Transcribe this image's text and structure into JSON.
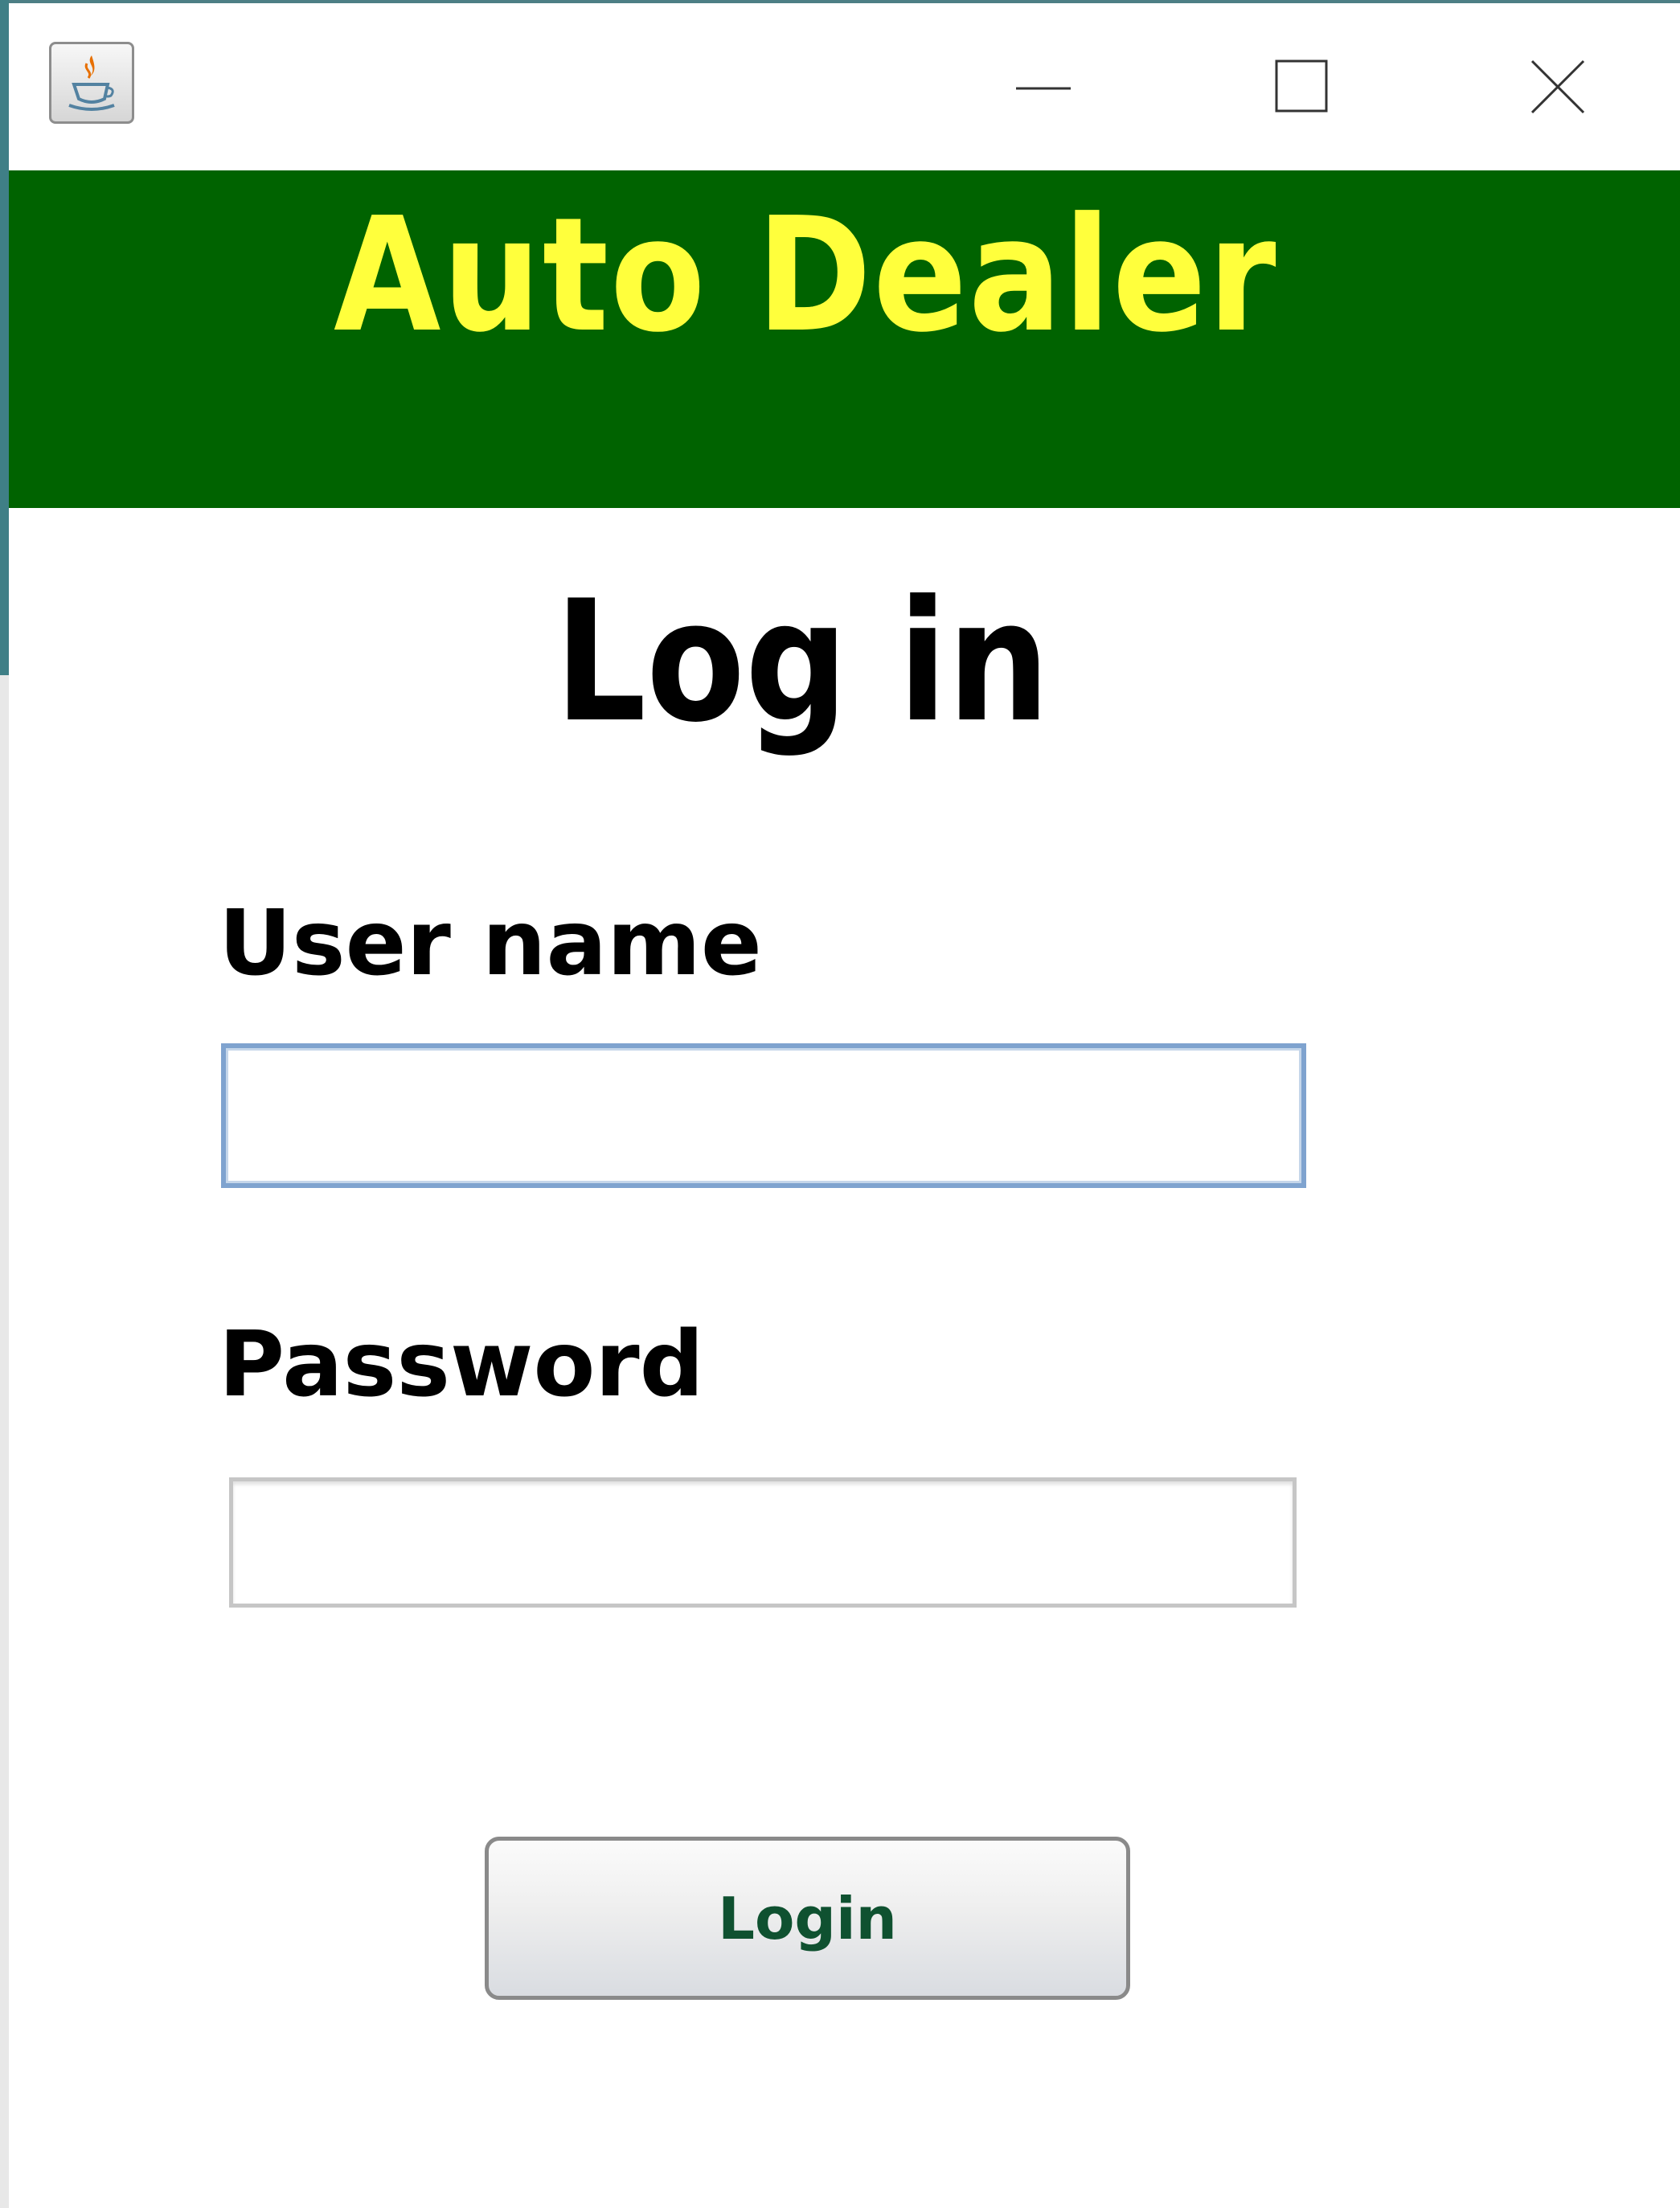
{
  "titlebar": {
    "app_icon": "java-cup-icon",
    "controls": {
      "minimize_icon": "minimize-icon",
      "maximize_icon": "maximize-icon",
      "close_icon": "close-icon"
    }
  },
  "banner": {
    "title": "Auto Dealer",
    "background_color": "#006300",
    "text_color": "#ffff3c"
  },
  "form": {
    "heading": "Log in",
    "username": {
      "label": "User name",
      "value": ""
    },
    "password": {
      "label": "Password",
      "value": ""
    },
    "login_button": {
      "label": "Login",
      "text_color": "#0f5130"
    }
  }
}
